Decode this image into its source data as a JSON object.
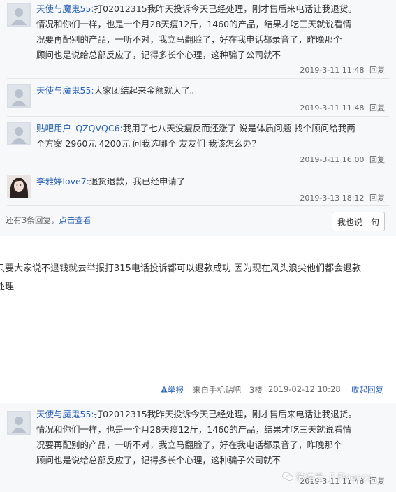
{
  "replies_top": [
    {
      "user": "天使与魔鬼55:",
      "lines": [
        "打02012315我昨天投诉今天已经处理，刚才售后来电话让我退货。",
        "情况和你们一样，也是一个月28天瘦12斤，1460的产品，结果才吃三天就说看情",
        "况要再配别的产品，一听不对，我立马翻脸了，好在我电话都录音了，昨晚那个",
        "顾问也是说给总部反应了，记得多长个心理，这种骗子公司就不"
      ],
      "time": "2019-3-11 11:48",
      "reply": "回复"
    },
    {
      "user": "天使与魔鬼55:",
      "lines": [
        "大家团结起来金额就大了。"
      ],
      "time": "2019-3-11 11:48",
      "reply": "回复"
    },
    {
      "user": "贴吧用户_QZQVQC6:",
      "lines": [
        "我用了七八天没瘦反而还涨了 说是体质问题 找个顾问给我两",
        "个方案 2960元 4200元 问我选哪个 友友们 我该怎么办？"
      ],
      "time": "2019-3-11 16:00",
      "reply": "回复"
    },
    {
      "user": "李雅婷love7:",
      "lines": [
        "退货退款，我已经申请了"
      ],
      "time": "2019-3-13 18:12",
      "reply": "回复"
    }
  ],
  "more_replies": {
    "prefix": "还有3条回复，",
    "link": "点击查看"
  },
  "say_button": "我也说一句",
  "floor_post": {
    "lines": [
      "只要大家说不退钱就去举报打315电话投诉都可以退款成功 因为现在风头浪尖他们都会退款",
      "处理"
    ]
  },
  "floor_meta": {
    "report": "举报",
    "source": "来自手机贴吧",
    "floor": "3楼",
    "time": "2019-02-12 10:28",
    "collapse": "收起回复"
  },
  "reply_bottom": {
    "user": "天使与魔鬼55:",
    "lines": [
      "打02012315我昨天投诉今天已经处理，刚才售后来电话让我退货。",
      "情况和你们一样，也是一个月28天瘦12斤，1460的产品，结果才吃三天就说看情",
      "况要再配别的产品，一听不对，我立马翻脸了，好在我电话都录音了，昨晚那个",
      "顾问也是说给总部反应了，记得多长个心理，这种骗子公司就不"
    ],
    "time": "2019-3-11 11:48",
    "reply": "回复"
  },
  "watermark": "微信号: F-Finance",
  "colors": {
    "link": "#2d64b3",
    "panel_bg": "#f7f8fa",
    "text": "#333333",
    "meta": "#666666"
  }
}
